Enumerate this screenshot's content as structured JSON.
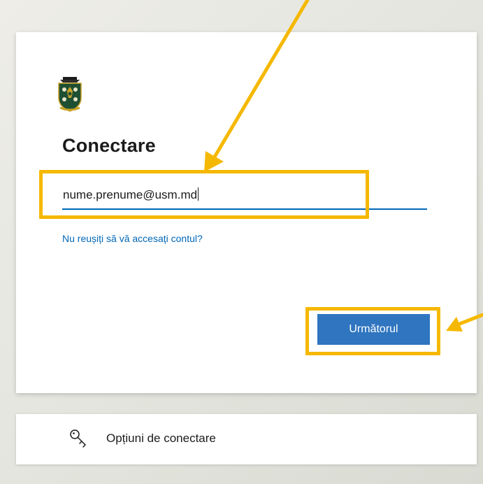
{
  "signin": {
    "heading": "Conectare",
    "email": {
      "value": "nume.prenume@usm.md"
    },
    "help_link": "Nu reușiți să vă accesați contul?",
    "next_button": "Următorul"
  },
  "options": {
    "label": "Opțiuni de conectare",
    "icon": "key-icon"
  },
  "logo": {
    "icon": "university-crest-logo",
    "colors": {
      "shield": "#1f4f33",
      "gold": "#c9a227"
    }
  },
  "annotations": {
    "color": "#f5b800"
  },
  "colors": {
    "accent": "#0067b8",
    "button": "#2f75c0",
    "highlight": "#f5b800"
  }
}
